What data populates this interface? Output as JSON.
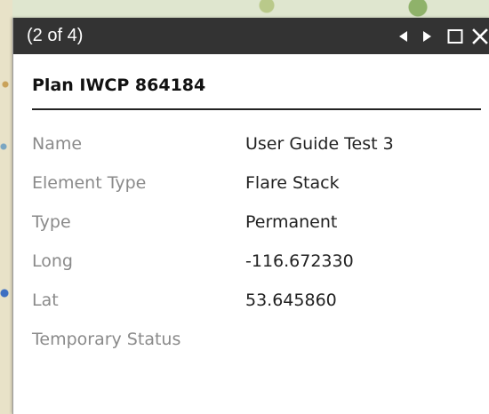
{
  "popup": {
    "counter": "(2 of 4)",
    "icons": {
      "previous": "previous-arrow-icon",
      "next": "next-arrow-icon",
      "maximize": "maximize-icon",
      "close": "close-icon"
    },
    "title": "Plan IWCP 864184",
    "attributes": [
      {
        "label": "Name",
        "value": "User Guide Test 3"
      },
      {
        "label": "Element Type",
        "value": "Flare Stack"
      },
      {
        "label": "Type",
        "value": "Permanent"
      },
      {
        "label": "Long",
        "value": "-116.672330"
      },
      {
        "label": "Lat",
        "value": "53.645860"
      },
      {
        "label": "Temporary Status",
        "value": ""
      }
    ]
  },
  "colors": {
    "titlebar": "#333333",
    "label": "#8a8a8a",
    "value": "#222222"
  }
}
